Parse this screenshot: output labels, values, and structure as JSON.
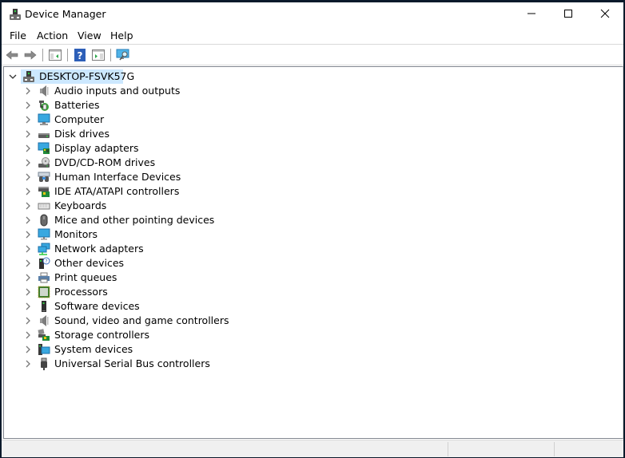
{
  "window": {
    "title": "Device Manager"
  },
  "title_buttons": {
    "minimize": "minimize",
    "maximize": "maximize",
    "close": "close"
  },
  "menu": [
    {
      "label": "File"
    },
    {
      "label": "Action"
    },
    {
      "label": "View"
    },
    {
      "label": "Help"
    }
  ],
  "toolbar": [
    {
      "name": "back-button",
      "icon": "back-arrow-icon"
    },
    {
      "name": "forward-button",
      "icon": "forward-arrow-icon"
    },
    {
      "name": "show-hide-console-tree-button",
      "icon": "console-tree-icon"
    },
    {
      "name": "help-button",
      "icon": "help-icon"
    },
    {
      "name": "show-hide-action-pane-button",
      "icon": "action-pane-icon"
    },
    {
      "name": "scan-hardware-button",
      "icon": "scan-monitor-icon"
    }
  ],
  "tree": {
    "root": {
      "label": "DESKTOP-FSVK57G",
      "expanded": true,
      "selected": true
    },
    "categories": [
      {
        "label": "Audio inputs and outputs",
        "icon": "speaker-icon"
      },
      {
        "label": "Batteries",
        "icon": "battery-icon"
      },
      {
        "label": "Computer",
        "icon": "computer-icon"
      },
      {
        "label": "Disk drives",
        "icon": "disk-drive-icon"
      },
      {
        "label": "Display adapters",
        "icon": "display-adapter-icon"
      },
      {
        "label": "DVD/CD-ROM drives",
        "icon": "dvd-drive-icon"
      },
      {
        "label": "Human Interface Devices",
        "icon": "hid-icon"
      },
      {
        "label": "IDE ATA/ATAPI controllers",
        "icon": "ide-controller-icon"
      },
      {
        "label": "Keyboards",
        "icon": "keyboard-icon"
      },
      {
        "label": "Mice and other pointing devices",
        "icon": "mouse-icon"
      },
      {
        "label": "Monitors",
        "icon": "monitor-icon"
      },
      {
        "label": "Network adapters",
        "icon": "network-adapter-icon"
      },
      {
        "label": "Other devices",
        "icon": "unknown-device-icon"
      },
      {
        "label": "Print queues",
        "icon": "printer-icon"
      },
      {
        "label": "Processors",
        "icon": "processor-icon"
      },
      {
        "label": "Software devices",
        "icon": "software-device-icon"
      },
      {
        "label": "Sound, video and game controllers",
        "icon": "speaker-icon"
      },
      {
        "label": "Storage controllers",
        "icon": "storage-controller-icon"
      },
      {
        "label": "System devices",
        "icon": "system-devices-icon"
      },
      {
        "label": "Universal Serial Bus controllers",
        "icon": "usb-icon"
      }
    ]
  },
  "statusbar": {
    "panes": [
      "",
      "",
      ""
    ]
  }
}
